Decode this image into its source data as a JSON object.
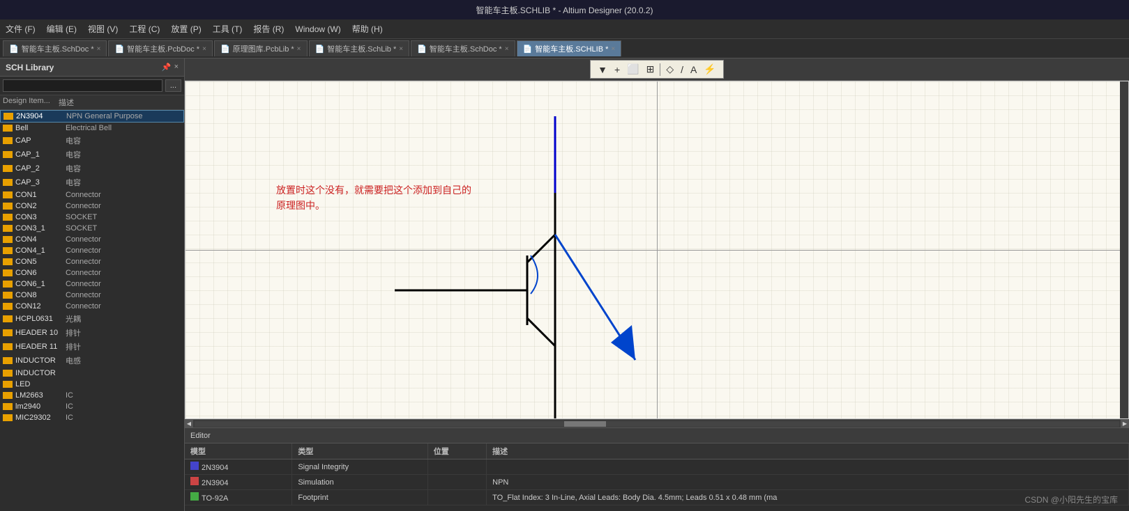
{
  "titlebar": {
    "text": "智能车主板.SCHLIB * - Altium Designer (20.0.2)"
  },
  "menubar": {
    "items": [
      "文件 (F)",
      "编辑 (E)",
      "视图 (V)",
      "工程 (C)",
      "放置 (P)",
      "工具 (T)",
      "报告 (R)",
      "Window (W)",
      "帮助 (H)"
    ]
  },
  "tabs": [
    {
      "id": "schdoc1",
      "label": "智能车主板.SchDoc *",
      "active": false,
      "icon": "📄"
    },
    {
      "id": "pcbdoc",
      "label": "智能车主板.PcbDoc *",
      "active": false,
      "icon": "📄"
    },
    {
      "id": "pcblib",
      "label": "原理图库.PcbLib *",
      "active": false,
      "icon": "📄"
    },
    {
      "id": "schlib1",
      "label": "智能车主板.SchLib *",
      "active": false,
      "icon": "📄"
    },
    {
      "id": "schdoc2",
      "label": "智能车主板.SchDoc *",
      "active": false,
      "icon": "📄"
    },
    {
      "id": "schlib2",
      "label": "智能车主板.SCHLIB *",
      "active": true,
      "icon": "📄"
    }
  ],
  "sidebar": {
    "title": "SCH Library",
    "search_placeholder": "",
    "columns": {
      "name": "Design Item...",
      "desc": "描述"
    },
    "items": [
      {
        "name": "2N3904",
        "desc": "NPN General Purpose",
        "selected": true
      },
      {
        "name": "Bell",
        "desc": "Electrical Bell"
      },
      {
        "name": "CAP",
        "desc": "电容"
      },
      {
        "name": "CAP_1",
        "desc": "电容"
      },
      {
        "name": "CAP_2",
        "desc": "电容"
      },
      {
        "name": "CAP_3",
        "desc": "电容"
      },
      {
        "name": "CON1",
        "desc": "Connector"
      },
      {
        "name": "CON2",
        "desc": "Connector"
      },
      {
        "name": "CON3",
        "desc": "SOCKET"
      },
      {
        "name": "CON3_1",
        "desc": "SOCKET"
      },
      {
        "name": "CON4",
        "desc": "Connector"
      },
      {
        "name": "CON4_1",
        "desc": "Connector"
      },
      {
        "name": "CON5",
        "desc": "Connector"
      },
      {
        "name": "CON6",
        "desc": "Connector"
      },
      {
        "name": "CON6_1",
        "desc": "Connector"
      },
      {
        "name": "CON8",
        "desc": "Connector"
      },
      {
        "name": "CON12",
        "desc": "Connector"
      },
      {
        "name": "HCPL0631",
        "desc": "光耦"
      },
      {
        "name": "HEADER 10",
        "desc": "排针"
      },
      {
        "name": "HEADER 11",
        "desc": "排针"
      },
      {
        "name": "INDUCTOR",
        "desc": "电感"
      },
      {
        "name": "INDUCTOR",
        "desc": ""
      },
      {
        "name": "LED",
        "desc": ""
      },
      {
        "name": "LM2663",
        "desc": "IC"
      },
      {
        "name": "lm2940",
        "desc": "IC"
      },
      {
        "name": "MIC29302",
        "desc": "IC"
      }
    ]
  },
  "canvas": {
    "annotation_line1": "放置时这个没有，就需要把这个添加到自己的",
    "annotation_line2": "原理图中。",
    "annotation_color": "#cc2222"
  },
  "toolbar_buttons": [
    "filter",
    "add",
    "box",
    "move",
    "split",
    "polygon",
    "line",
    "text",
    "power"
  ],
  "editor": {
    "title": "Editor",
    "columns": [
      "模型",
      "类型",
      "位置",
      "描述"
    ],
    "rows": [
      {
        "model": "2N3904",
        "type": "Signal Integrity",
        "location": "",
        "desc": ""
      },
      {
        "model": "2N3904",
        "type": "Simulation",
        "location": "",
        "desc": "NPN"
      },
      {
        "model": "TO-92A",
        "type": "Footprint",
        "location": "",
        "desc": "TO_Flat Index: 3 In-Line, Axial Leads: Body Dia. 4.5mm; Leads 0.51 x 0.48 mm (ma"
      }
    ]
  },
  "watermark": "CSDN @小阳先生的宝库"
}
